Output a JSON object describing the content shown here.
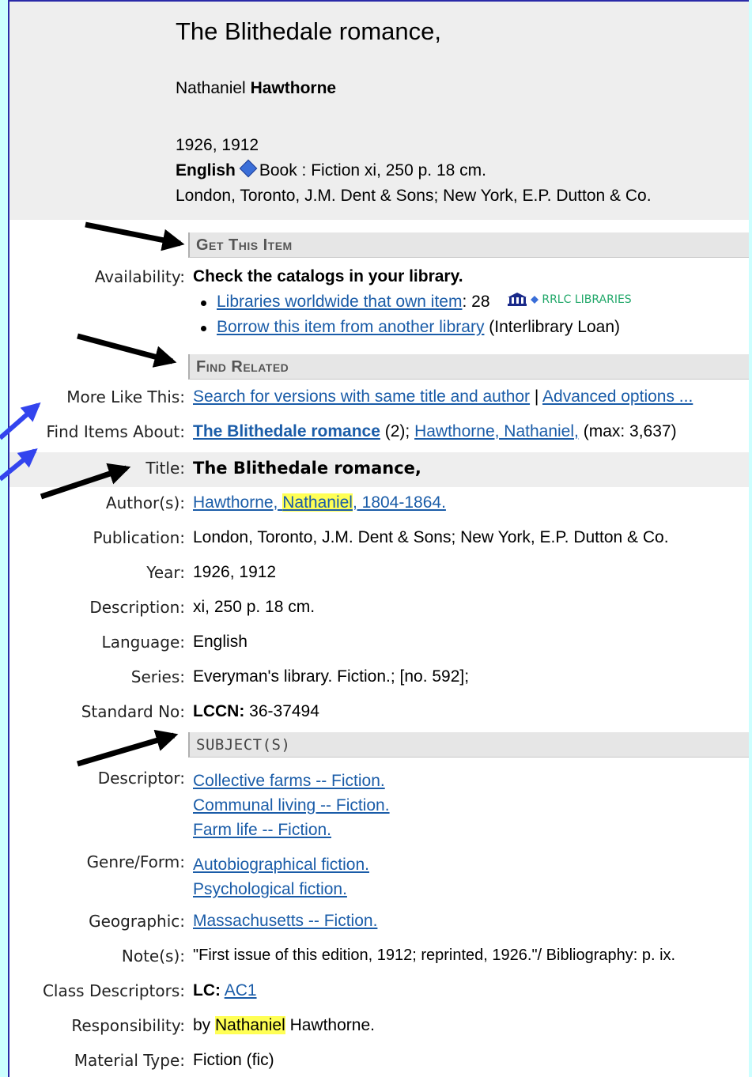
{
  "record": {
    "title": "The Blithedale romance,",
    "author_first": "Nathaniel ",
    "author_last": "Hawthorne",
    "year": "1926, 1912",
    "language": "English",
    "format": "Book : Fiction xi, 250 p. 18 cm.",
    "publication": "London, Toronto, J.M. Dent & Sons; New York, E.P. Dutton & Co."
  },
  "sections": {
    "get_item": "Get This Item",
    "find_related": "Find Related",
    "subjects": "SUBJECT(S)"
  },
  "get_item": {
    "availability_label": "Availability:",
    "availability_value": "Check the catalogs in your library.",
    "libraries_link": "Libraries worldwide that own item",
    "libraries_count": ": 28",
    "rrlc_label": "RRLC LIBRARIES",
    "borrow_link": "Borrow this item from another library",
    "borrow_note": " (Interlibrary Loan)"
  },
  "find_related": {
    "more_like_label": "More Like This:",
    "more_like_link": "Search for versions with same title and author",
    "sep": " | ",
    "advanced_link": "Advanced options ...",
    "find_items_label": "Find Items About:",
    "find_items_link1": "The Blithedale romance",
    "find_items_count1": " (2); ",
    "find_items_link2": "Hawthorne, Nathaniel,",
    "find_items_count2": " (max: 3,637)"
  },
  "details": {
    "title_label": "Title:",
    "title_value": "The Blithedale romance,",
    "author_label": "Author(s):",
    "author_a": "Hawthorne, ",
    "author_hl": "Nathaniel",
    "author_b": ", 1804-1864.",
    "publication_label": "Publication:",
    "publication_value": "London, Toronto, J.M. Dent & Sons; New York, E.P. Dutton & Co.",
    "year_label": "Year:",
    "year_value": "1926, 1912",
    "description_label": "Description:",
    "description_value": "xi, 250 p. 18 cm.",
    "language_label": "Language:",
    "language_value": "English",
    "series_label": "Series:",
    "series_value": "Everyman's library. Fiction.; [no. 592];",
    "standard_label": "Standard No:",
    "standard_key": "LCCN:",
    "standard_value": " 36-37494"
  },
  "subjects": {
    "descriptor_label": "Descriptor:",
    "descriptors": [
      "Collective farms -- Fiction.",
      "Communal living -- Fiction.",
      "Farm life -- Fiction."
    ],
    "genre_label": "Genre/Form:",
    "genres": [
      "Autobiographical fiction.",
      "Psychological fiction."
    ],
    "geographic_label": "Geographic:",
    "geographic": "Massachusetts -- Fiction.",
    "notes_label": "Note(s):",
    "notes_value": "\"First issue of this edition, 1912; reprinted, 1926.\"/ Bibliography: p. ix.",
    "class_label": "Class Descriptors:",
    "class_key": "LC:",
    "class_link": "AC1",
    "resp_label": "Responsibility:",
    "resp_a": "by ",
    "resp_hl": "Nathaniel",
    "resp_b": " Hawthorne.",
    "material_label": "Material Type:",
    "material_value": "Fiction (fic)"
  },
  "colors": {
    "background": "#ccffff",
    "link": "#1a5ca8",
    "highlight": "#ffff55",
    "arrow_black": "#000000",
    "arrow_blue": "#3344ee"
  }
}
